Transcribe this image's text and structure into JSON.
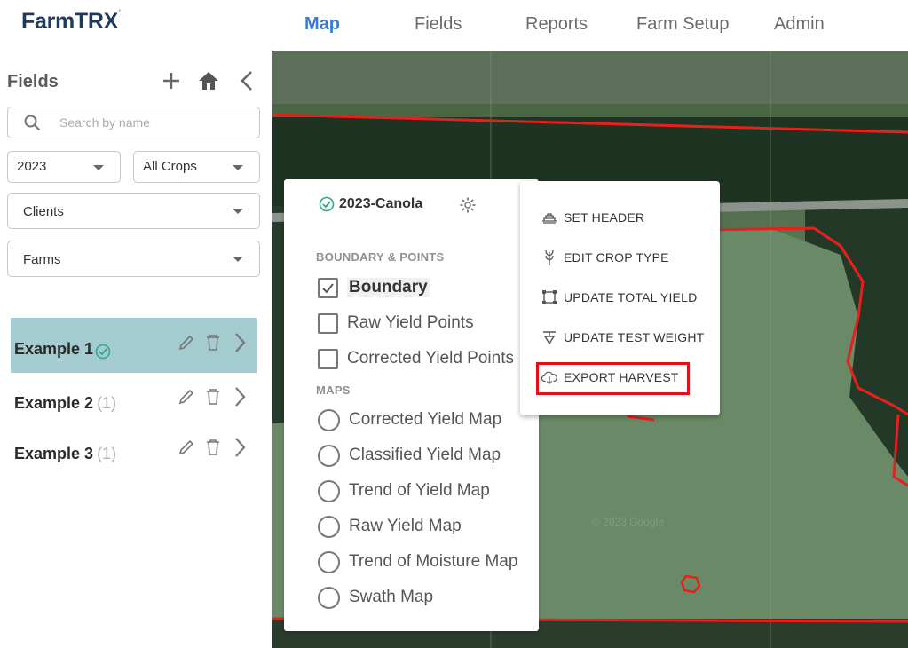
{
  "brand": {
    "logo": "FarmTRX",
    "trademark": "´"
  },
  "nav": {
    "items": [
      {
        "label": "Map",
        "active": true
      },
      {
        "label": "Fields",
        "active": false
      },
      {
        "label": "Reports",
        "active": false
      },
      {
        "label": "Farm Setup",
        "active": false
      },
      {
        "label": "Admin",
        "active": false
      }
    ]
  },
  "sidebar": {
    "title": "Fields",
    "search_placeholder": "Search by name",
    "year": "2023",
    "crops": "All Crops",
    "clients": "Clients",
    "farms": "Farms",
    "fields": [
      {
        "name": "Example 1",
        "count": "",
        "selected": true,
        "status": "check"
      },
      {
        "name": "Example 2",
        "count": "(1)",
        "selected": false
      },
      {
        "name": "Example 3",
        "count": "(1)",
        "selected": false
      }
    ]
  },
  "layers_panel": {
    "harvest": "2023-Canola",
    "boundary_section": "BOUNDARY & POINTS",
    "checkboxes": [
      {
        "label": "Boundary",
        "checked": true
      },
      {
        "label": "Raw Yield Points",
        "checked": false
      },
      {
        "label": "Corrected Yield Points",
        "checked": false
      }
    ],
    "maps_section": "MAPS",
    "maps": [
      {
        "label": "Corrected Yield Map"
      },
      {
        "label": "Classified Yield Map"
      },
      {
        "label": "Trend of Yield Map"
      },
      {
        "label": "Raw Yield Map"
      },
      {
        "label": "Trend of Moisture Map"
      },
      {
        "label": "Swath Map"
      }
    ]
  },
  "context_menu": {
    "items": [
      {
        "label": "SET HEADER",
        "icon": "header-icon"
      },
      {
        "label": "EDIT CROP TYPE",
        "icon": "wheat-icon"
      },
      {
        "label": "UPDATE TOTAL YIELD",
        "icon": "crop-frame-icon"
      },
      {
        "label": "UPDATE TEST WEIGHT",
        "icon": "scale-icon"
      },
      {
        "label": "EXPORT HARVEST",
        "icon": "cloud-download-icon",
        "highlighted": true
      }
    ]
  },
  "map": {
    "watermark": "© 2023 Google"
  },
  "colors": {
    "accent": "#3a7bd5",
    "selected_row": "#a4ccd0",
    "boundary": "#e8201c",
    "highlight": "#e3101c",
    "check": "#2fa88a"
  }
}
